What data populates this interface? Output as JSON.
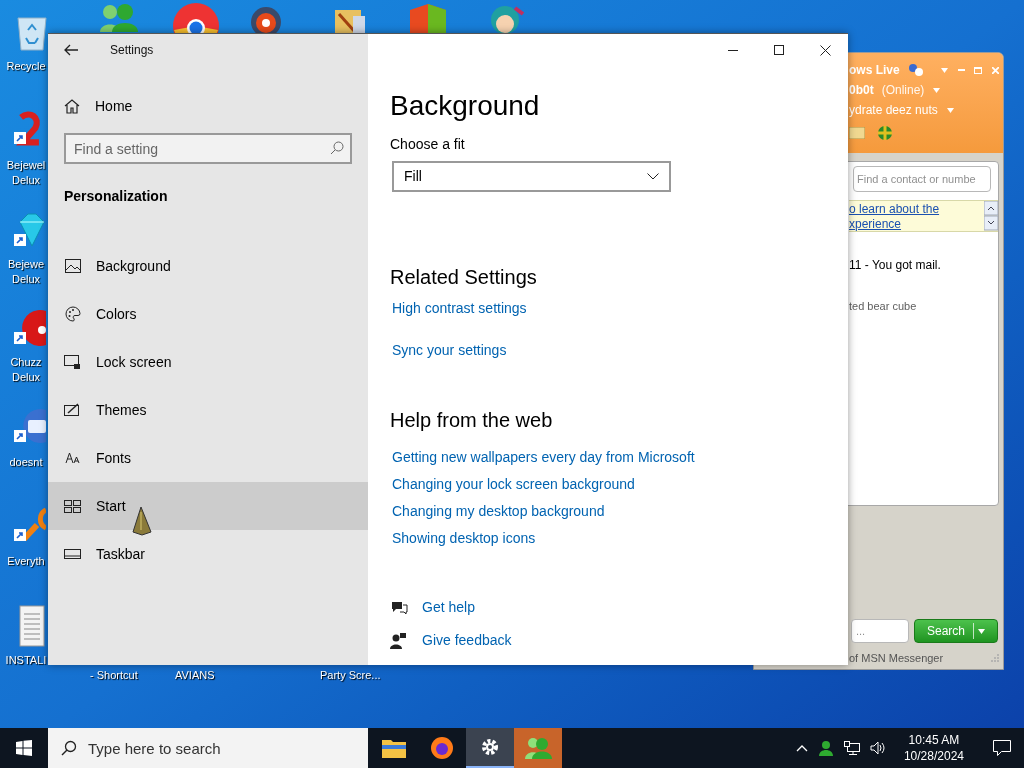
{
  "desktop": {
    "left_icons": [
      {
        "lines": [
          "Recycle"
        ]
      },
      {
        "lines": [
          "Bejewel",
          "Delux"
        ]
      },
      {
        "lines": [
          "Bejewe",
          "Delux"
        ]
      },
      {
        "lines": [
          "Chuzz",
          "Delux"
        ]
      },
      {
        "lines": [
          "doesnt"
        ]
      },
      {
        "lines": [
          "Everyth"
        ]
      },
      {
        "lines": [
          "INSTALI"
        ]
      }
    ],
    "bottom_labels": [
      "- Shortcut",
      "AVIANS",
      "Party Scre..."
    ]
  },
  "settings": {
    "title": "Settings",
    "home": "Home",
    "search": {
      "placeholder": "Find a setting"
    },
    "section": "Personalization",
    "nav": [
      {
        "label": "Background",
        "selected": false
      },
      {
        "label": "Colors",
        "selected": false
      },
      {
        "label": "Lock screen",
        "selected": false
      },
      {
        "label": "Themes",
        "selected": false
      },
      {
        "label": "Fonts",
        "selected": false
      },
      {
        "label": "Start",
        "selected": true
      },
      {
        "label": "Taskbar",
        "selected": false
      }
    ],
    "page_title": "Background",
    "fit_label": "Choose a fit",
    "fit_value": "Fill",
    "related_heading": "Related Settings",
    "related_links": [
      "High contrast settings",
      "Sync your settings"
    ],
    "help_heading": "Help from the web",
    "help_links": [
      "Getting new wallpapers every day from Microsoft",
      "Changing your lock screen background",
      "Changing my desktop background",
      "Showing desktop icons"
    ],
    "actions": [
      "Get help",
      "Give feedback"
    ]
  },
  "messenger": {
    "title": "ows Live",
    "user": "0b0t",
    "status": "(Online)",
    "personal_message": "ydrate deez nuts",
    "search": {
      "placeholder": "Find a contact or numbe"
    },
    "banner_lines": [
      "o learn about the",
      "xperience"
    ],
    "items": [
      "11 - You got mail.",
      "ted bear cube"
    ],
    "bottom_field": {
      "placeholder": "..."
    },
    "search_button": "Search",
    "footer": "of MSN Messenger"
  },
  "taskbar": {
    "search": {
      "placeholder": "Type here to search"
    },
    "apps": [
      {
        "kind": "folder",
        "selected": false,
        "attention": false
      },
      {
        "kind": "firefox",
        "selected": false,
        "attention": false
      },
      {
        "kind": "settings",
        "selected": true,
        "attention": false
      },
      {
        "kind": "messenger",
        "selected": false,
        "attention": true
      }
    ],
    "time": "10:45 AM",
    "date": "10/28/2024"
  }
}
